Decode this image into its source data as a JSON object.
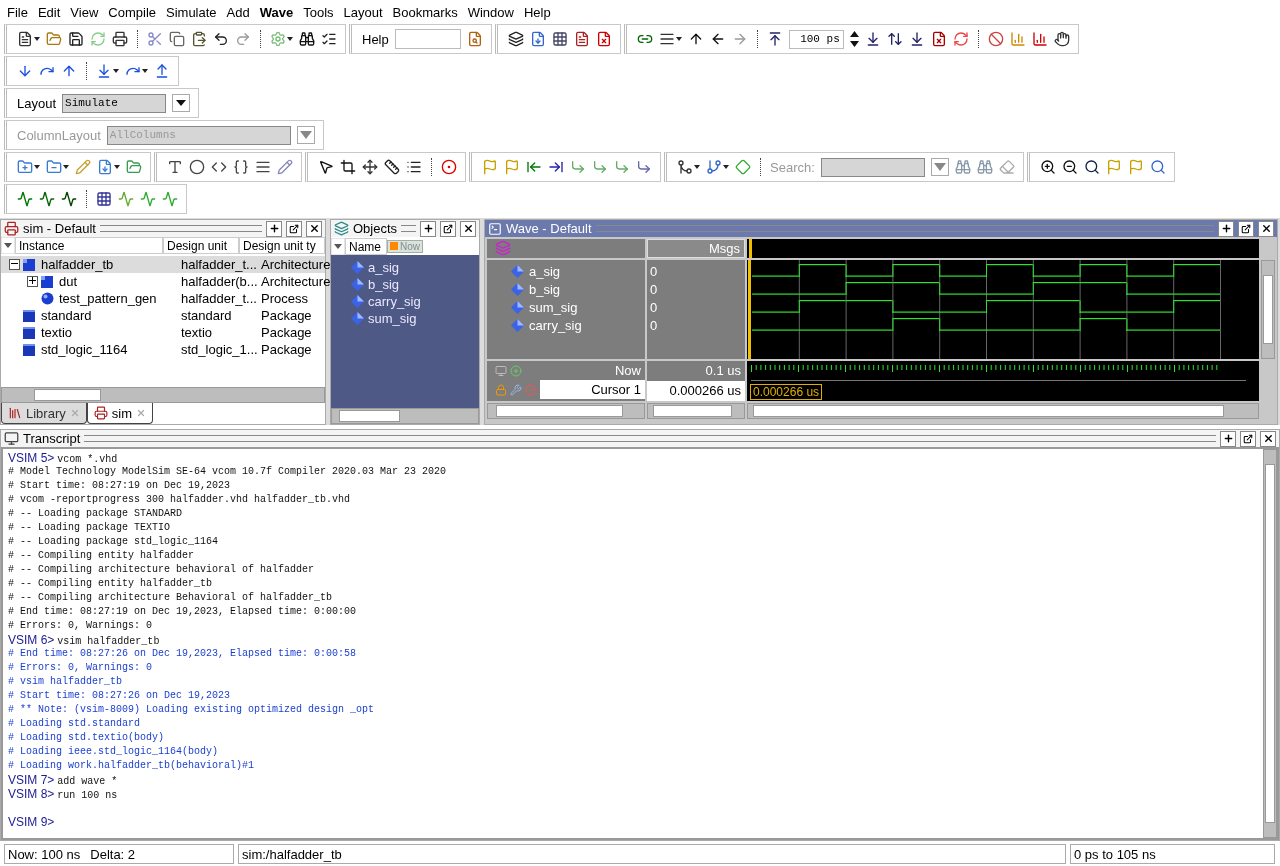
{
  "menu": [
    {
      "label": "File",
      "active": false
    },
    {
      "label": "Edit",
      "active": false
    },
    {
      "label": "View",
      "active": false
    },
    {
      "label": "Compile",
      "active": false
    },
    {
      "label": "Simulate",
      "active": false
    },
    {
      "label": "Add",
      "active": false
    },
    {
      "label": "Wave",
      "active": true
    },
    {
      "label": "Tools",
      "active": false
    },
    {
      "label": "Layout",
      "active": false
    },
    {
      "label": "Bookmarks",
      "active": false
    },
    {
      "label": "Window",
      "active": false
    },
    {
      "label": "Help",
      "active": false
    }
  ],
  "toolbar": {
    "help_label": "Help",
    "time_step": "100 ps",
    "layout": {
      "label": "Layout",
      "value": "Simulate",
      "disabled": false
    },
    "column_layout": {
      "label": "ColumnLayout",
      "value": "AllColumns",
      "disabled": true
    },
    "search": {
      "label": "Search:",
      "disabled": true
    }
  },
  "sim_panel": {
    "title": "sim - Default",
    "columns": [
      "Instance",
      "Design unit",
      "Design unit ty"
    ],
    "rows": [
      {
        "instance": "halfadder_tb",
        "design_unit": "halfadder_t...",
        "unit_type": "Architecture",
        "kind": "architecture",
        "selected": true,
        "expanded": true,
        "children": [
          {
            "instance": "dut",
            "design_unit": "halfadder(b...",
            "unit_type": "Architecture",
            "kind": "architecture",
            "selected": false,
            "expanded": false
          },
          {
            "instance": "test_pattern_gen",
            "design_unit": "halfadder_t...",
            "unit_type": "Process",
            "kind": "process",
            "selected": false
          }
        ]
      },
      {
        "instance": "standard",
        "design_unit": "standard",
        "unit_type": "Package",
        "kind": "package",
        "selected": false
      },
      {
        "instance": "textio",
        "design_unit": "textio",
        "unit_type": "Package",
        "kind": "package",
        "selected": false
      },
      {
        "instance": "std_logic_1164",
        "design_unit": "std_logic_1...",
        "unit_type": "Package",
        "kind": "package",
        "selected": false
      }
    ],
    "tabs": [
      {
        "label": "Library",
        "selected": false
      },
      {
        "label": "sim",
        "selected": true
      }
    ]
  },
  "objects_panel": {
    "title": "Objects",
    "column": "Name",
    "now_label": "Now",
    "items": [
      {
        "name": "a_sig"
      },
      {
        "name": "b_sig"
      },
      {
        "name": "carry_sig"
      },
      {
        "name": "sum_sig"
      }
    ]
  },
  "wave_panel": {
    "title": "Wave - Default",
    "msgs_label": "Msgs",
    "signals": [
      {
        "name": "a_sig",
        "value": "0",
        "high": [
          false,
          true,
          false,
          true,
          false,
          true,
          false,
          true,
          false,
          true
        ]
      },
      {
        "name": "b_sig",
        "value": "0",
        "high": [
          false,
          false,
          true,
          true,
          false,
          false,
          true,
          true,
          false,
          false
        ]
      },
      {
        "name": "sum_sig",
        "value": "0",
        "high": [
          false,
          true,
          true,
          false,
          false,
          true,
          true,
          false,
          false,
          true
        ]
      },
      {
        "name": "carry_sig",
        "value": "0",
        "high": [
          false,
          false,
          false,
          true,
          false,
          false,
          false,
          true,
          false,
          false
        ]
      }
    ],
    "now_label": "Now",
    "now_value": "0.1 us",
    "cursor_label": "Cursor 1",
    "cursor_value": "0.000266 us",
    "cursor_marker": "0.000266 us"
  },
  "transcript": {
    "title": "Transcript",
    "lines": [
      {
        "kind": "prompt",
        "prompt": "VSIM 5>",
        "command": "vcom *.vhd"
      },
      {
        "kind": "log",
        "text": "# Model Technology ModelSim SE-64 vcom 10.7f Compiler 2020.03 Mar 23 2020"
      },
      {
        "kind": "log",
        "text": "# Start time: 08:27:19 on Dec 19,2023"
      },
      {
        "kind": "log",
        "text": "# vcom -reportprogress 300 halfadder.vhd halfadder_tb.vhd"
      },
      {
        "kind": "log",
        "text": "# -- Loading package STANDARD"
      },
      {
        "kind": "log",
        "text": "# -- Loading package TEXTIO"
      },
      {
        "kind": "log",
        "text": "# -- Loading package std_logic_1164"
      },
      {
        "kind": "log",
        "text": "# -- Compiling entity halfadder"
      },
      {
        "kind": "log",
        "text": "# -- Compiling architecture behavioral of halfadder"
      },
      {
        "kind": "log",
        "text": "# -- Compiling entity halfadder_tb"
      },
      {
        "kind": "log",
        "text": "# -- Compiling architecture Behavioral of halfadder_tb"
      },
      {
        "kind": "log",
        "text": "# End time: 08:27:19 on Dec 19,2023, Elapsed time: 0:00:00"
      },
      {
        "kind": "log",
        "text": "# Errors: 0, Warnings: 0"
      },
      {
        "kind": "prompt",
        "prompt": "VSIM 6>",
        "command": "vsim halfadder_tb"
      },
      {
        "kind": "info",
        "text": "# End time: 08:27:26 on Dec 19,2023, Elapsed time: 0:00:58"
      },
      {
        "kind": "info",
        "text": "# Errors: 0, Warnings: 0"
      },
      {
        "kind": "info",
        "text": "# vsim halfadder_tb"
      },
      {
        "kind": "info",
        "text": "# Start time: 08:27:26 on Dec 19,2023"
      },
      {
        "kind": "info",
        "text": "# ** Note: (vsim-8009) Loading existing optimized design _opt"
      },
      {
        "kind": "info",
        "text": "# Loading std.standard"
      },
      {
        "kind": "info",
        "text": "# Loading std.textio(body)"
      },
      {
        "kind": "info",
        "text": "# Loading ieee.std_logic_1164(body)"
      },
      {
        "kind": "info",
        "text": "# Loading work.halfadder_tb(behavioral)#1"
      },
      {
        "kind": "prompt",
        "prompt": "VSIM 7>",
        "command": "add wave *"
      },
      {
        "kind": "prompt",
        "prompt": "VSIM 8>",
        "command": "run 100 ns"
      },
      {
        "kind": "blank"
      },
      {
        "kind": "prompt",
        "prompt": "VSIM 9>"
      }
    ]
  },
  "status_bar": {
    "now": "Now: 100 ns",
    "delta": "Delta: 2",
    "context": "sim:/halfadder_tb",
    "range": "0 ps to 105 ns"
  }
}
